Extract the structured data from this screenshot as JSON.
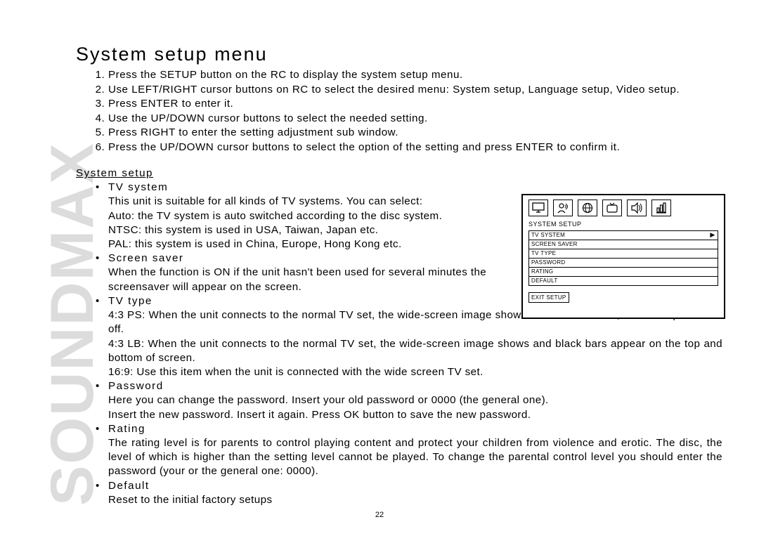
{
  "brand": "SOUNDMAX",
  "title": "System setup menu",
  "steps": [
    "Press the SETUP button on the RC to display the system setup menu.",
    "Use LEFT/RIGHT cursor buttons on RC to select the desired menu: System setup, Language setup, Video setup.",
    "Press ENTER to enter it.",
    "Use the UP/DOWN cursor buttons to select the needed setting.",
    "Press RIGHT to enter the setting adjustment sub window.",
    "Press the UP/DOWN cursor buttons to select the option of the setting and press ENTER to confirm it."
  ],
  "section_heading": "System setup",
  "items": [
    {
      "head": "TV system",
      "paras": [
        "This unit is suitable for all kinds of TV systems. You can select:",
        "Auto: the TV system is auto switched according to the disc system.",
        "NTSC: this system is used in USA, Taiwan, Japan etc.",
        "PAL: this system is used in China, Europe, Hong Kong etc."
      ],
      "narrow": true
    },
    {
      "head": "Screen saver",
      "paras": [
        "When the function is ON if the unit hasn't been used for several minutes the screensaver will appear on the screen."
      ],
      "narrow": true
    },
    {
      "head": "TV type",
      "paras": [
        "4:3 PS: When the unit connects to the normal TV set, the wide-screen image shows on the full screen, but some part is cut off.",
        "4:3 LB: When the unit connects to the normal TV set, the wide-screen image shows and black bars appear on the top and bottom of screen.",
        "16:9: Use this item when the unit is connected with the wide screen TV set."
      ],
      "justify": [
        true,
        true,
        false
      ]
    },
    {
      "head": "Password",
      "paras": [
        "Here you can change the password. Insert your old password or 0000 (the general one).",
        "Insert the new password. Insert it again. Press OK button to save the new password."
      ]
    },
    {
      "head": "Rating",
      "paras": [
        "The rating level is for parents to control playing content and protect your children from violence and erotic. The disc, the level of which is higher than the setting level cannot be played. To change the parental control level you should enter the password (your or the general one: 0000)."
      ],
      "justify": [
        true
      ]
    },
    {
      "head": "Default",
      "paras": [
        "Reset to the initial factory setups"
      ]
    }
  ],
  "osd": {
    "label": "SYSTEM SETUP",
    "rows": [
      "TV SYSTEM",
      "SCREEN SAVER",
      "TV TYPE",
      "PASSWORD",
      "RATING",
      "DEFAULT"
    ],
    "selected_index": 0,
    "exit": "EXIT SETUP",
    "icon_names": [
      "monitor-icon",
      "person-speak-icon",
      "globe-icon",
      "tv-icon",
      "speaker-icon",
      "digital-icon"
    ]
  },
  "page_number": "22"
}
